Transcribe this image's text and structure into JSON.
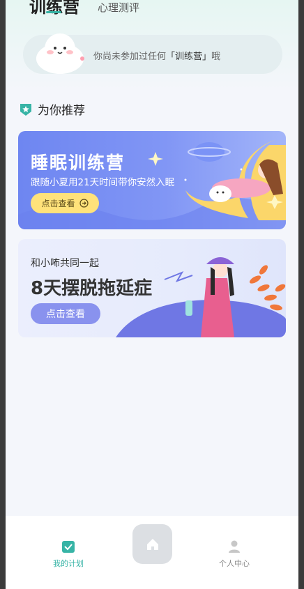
{
  "tabs": {
    "active_label": "训练营",
    "secondary_label": "心理测评"
  },
  "notice": {
    "prefix": "你尚未参加过任何",
    "highlight": "「训练营」",
    "suffix": "哦"
  },
  "section": {
    "icon": "star-badge-icon",
    "title": "为你推荐"
  },
  "card_sleep": {
    "title": "睡眠训练营",
    "subtitle": "跟随小夏用21天时间带你安然入眠",
    "button_label": "点击查看"
  },
  "card_procrastination": {
    "subtitle": "和小咘共同一起",
    "title": "8天摆脱拖延症",
    "button_label": "点击查看"
  },
  "bottom_nav": {
    "items": [
      {
        "label": "我的计划",
        "icon": "plan-check-icon",
        "active": true
      },
      {
        "label": "",
        "icon": "home-icon",
        "active": false
      },
      {
        "label": "个人中心",
        "icon": "person-icon",
        "active": false
      }
    ]
  },
  "colors": {
    "accent": "#37b4a6",
    "sleep_card": "#7a8ff3",
    "sleep_button": "#ffe27a",
    "procrast_button": "#8992ee"
  }
}
